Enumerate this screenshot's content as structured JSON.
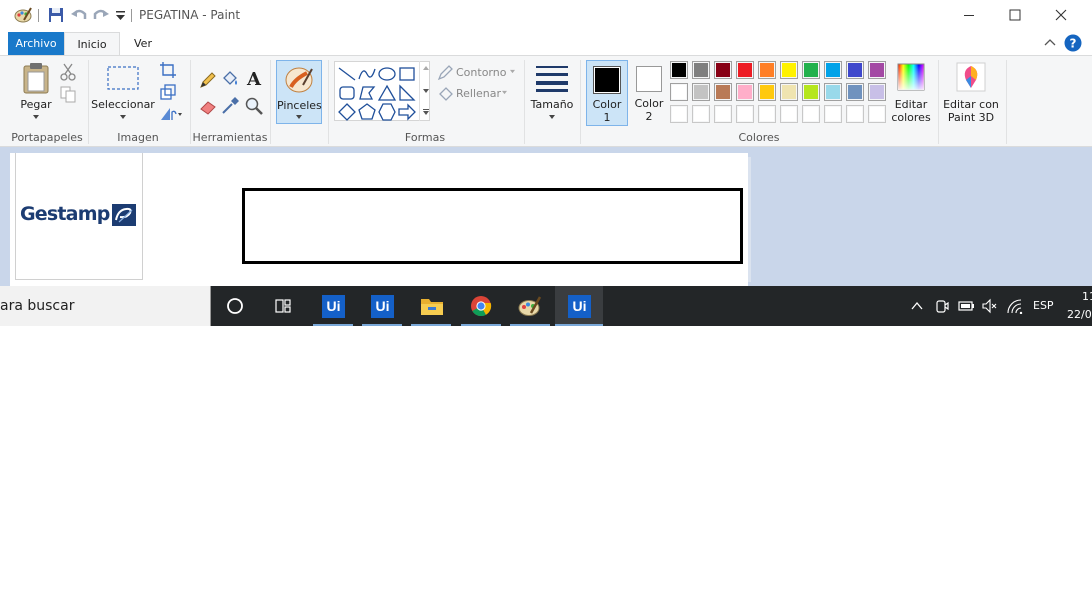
{
  "window": {
    "title": "PEGATINA - Paint"
  },
  "tabs": {
    "archivo": "Archivo",
    "inicio": "Inicio",
    "ver": "Ver"
  },
  "ribbon": {
    "portapapeles": {
      "pegar": "Pegar",
      "group": "Portapapeles"
    },
    "imagen": {
      "seleccionar": "Seleccionar",
      "group": "Imagen"
    },
    "herramientas": {
      "group": "Herramientas"
    },
    "pinceles": {
      "label": "Pinceles"
    },
    "formas": {
      "contorno": "Contorno",
      "rellenar": "Rellenar",
      "group": "Formas"
    },
    "tamano": {
      "label": "Tamaño"
    },
    "colores": {
      "color1_line1": "Color",
      "color1_line2": "1",
      "color2_line1": "Color",
      "color2_line2": "2",
      "group": "Colores",
      "editar_line1": "Editar",
      "editar_line2": "colores",
      "paint3d_line1": "Editar con",
      "paint3d_line2": "Paint 3D",
      "color1_value": "#000000",
      "color2_value": "#ffffff",
      "palette_row1": [
        "#000000",
        "#7f7f7f",
        "#880015",
        "#ed1c24",
        "#ff7f27",
        "#fff200",
        "#22b14c",
        "#00a2e8",
        "#3f48cc",
        "#a349a4"
      ],
      "palette_row2": [
        "#ffffff",
        "#c3c3c3",
        "#b97a57",
        "#ffaec9",
        "#ffc90e",
        "#efe4b0",
        "#b5e61d",
        "#99d9ea",
        "#7092be",
        "#c8bfe7"
      ],
      "palette_row3": [
        "#ffffff",
        "#ffffff",
        "#ffffff",
        "#ffffff",
        "#ffffff",
        "#ffffff",
        "#ffffff",
        "#ffffff",
        "#ffffff",
        "#ffffff"
      ]
    }
  },
  "canvas": {
    "logo_text": "Gestamp"
  },
  "taskbar": {
    "search_text": "ara buscar",
    "apps": [
      "cortana-icon",
      "task-view-icon",
      "uipath-icon",
      "uipath-icon",
      "file-explorer-icon",
      "chrome-icon",
      "paint-icon",
      "uipath-icon"
    ],
    "language": "ESP",
    "time": "11",
    "date": "22/0"
  }
}
